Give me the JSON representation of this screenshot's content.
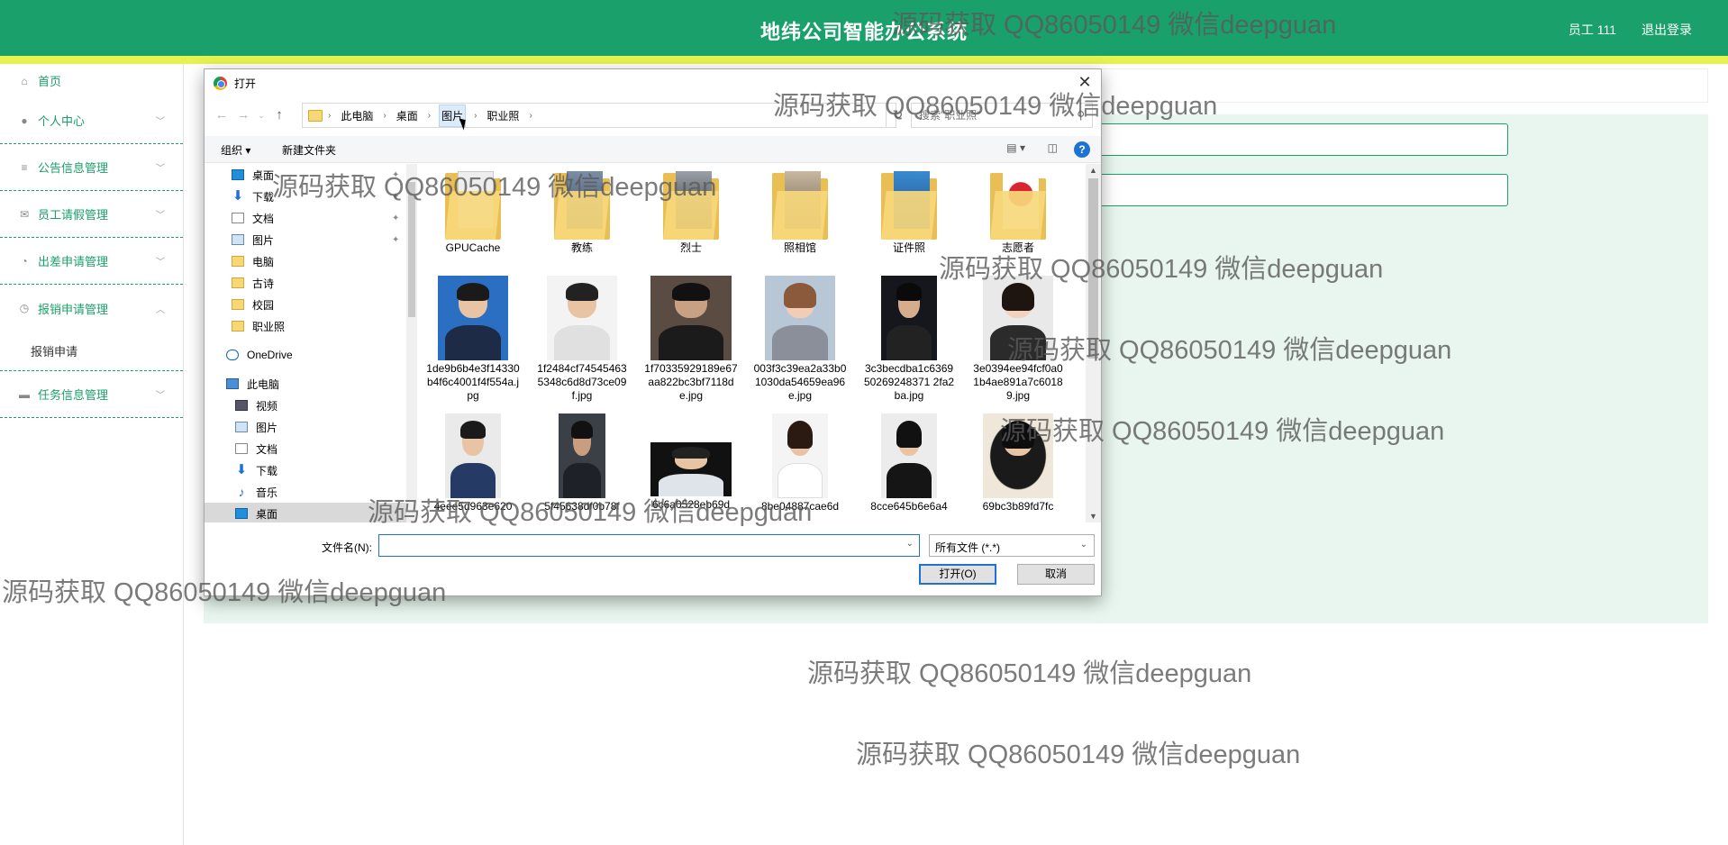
{
  "header": {
    "title": "地纬公司智能办公系统",
    "user": "员工 111",
    "logout": "退出登录"
  },
  "sidebar": {
    "items": [
      {
        "label": "首页",
        "icon": "home-icon"
      },
      {
        "label": "个人中心",
        "icon": "user-icon"
      },
      {
        "label": "公告信息管理",
        "icon": "list-icon"
      },
      {
        "label": "员工请假管理",
        "icon": "mail-icon"
      },
      {
        "label": "出差申请管理",
        "icon": "gauge-icon"
      },
      {
        "label": "报销申请管理",
        "icon": "clock-icon"
      },
      {
        "label": "任务信息管理",
        "icon": "monitor-icon"
      }
    ],
    "sub_item": "报销申请"
  },
  "dialog": {
    "title": "打开",
    "breadcrumbs": [
      "此电脑",
      "桌面",
      "图片",
      "职业照"
    ],
    "search_placeholder": "搜索\"职业照\"",
    "toolbar": {
      "organize": "组织 ▾",
      "new_folder": "新建文件夹"
    },
    "tree": [
      {
        "label": "桌面",
        "icon": "desktop-icon",
        "pinned": true
      },
      {
        "label": "下载",
        "icon": "download-icon",
        "pinned": true
      },
      {
        "label": "文档",
        "icon": "document-icon",
        "pinned": true
      },
      {
        "label": "图片",
        "icon": "picture-icon",
        "pinned": true
      },
      {
        "label": "电脑",
        "icon": "folder-icon"
      },
      {
        "label": "古诗",
        "icon": "folder-icon"
      },
      {
        "label": "校园",
        "icon": "folder-icon"
      },
      {
        "label": "职业照",
        "icon": "folder-icon"
      },
      {
        "label": "OneDrive",
        "icon": "onedrive-icon"
      },
      {
        "label": "此电脑",
        "icon": "computer-icon"
      },
      {
        "label": "视频",
        "icon": "video-icon"
      },
      {
        "label": "图片",
        "icon": "picture-icon"
      },
      {
        "label": "文档",
        "icon": "document-icon"
      },
      {
        "label": "下载",
        "icon": "download-icon"
      },
      {
        "label": "音乐",
        "icon": "music-icon"
      },
      {
        "label": "桌面",
        "icon": "desktop-icon"
      }
    ],
    "files": [
      {
        "name": "GPUCache",
        "kind": "folder"
      },
      {
        "name": "教练",
        "kind": "folder"
      },
      {
        "name": "烈士",
        "kind": "folder"
      },
      {
        "name": "照相馆",
        "kind": "folder"
      },
      {
        "name": "证件照",
        "kind": "folder"
      },
      {
        "name": "志愿者",
        "kind": "folder"
      },
      {
        "name": "1de9b6b4e3f14330b4f6c4001f4f554a.jpg",
        "kind": "photo"
      },
      {
        "name": "1f2484cf745454635348c6d8d73ce09f.jpg",
        "kind": "photo"
      },
      {
        "name": "1f70335929189e67aa822bc3bf7118de.jpg",
        "kind": "photo"
      },
      {
        "name": "003f3c39ea2a33b01030da54659ea96e.jpg",
        "kind": "photo"
      },
      {
        "name": "3c3becdba1c636950269248371 2fa2ba.jpg",
        "kind": "photo"
      },
      {
        "name": "3e0394ee94fcf0a01b4ae891a7c60189.jpg",
        "kind": "photo"
      },
      {
        "name": "4eee5d963e620",
        "kind": "photo"
      },
      {
        "name": "5f45638df0b78f",
        "kind": "photo"
      },
      {
        "name": "6c6a0528eb69d",
        "kind": "photo"
      },
      {
        "name": "8be04887cae6d",
        "kind": "photo"
      },
      {
        "name": "8cce645b6e6a4",
        "kind": "photo"
      },
      {
        "name": "69bc3b89fd7fc",
        "kind": "photo"
      }
    ],
    "filename_label": "文件名(N):",
    "filename_value": "",
    "filetype": "所有文件 (*.*)",
    "open_button": "打开(O)",
    "cancel_button": "取消"
  },
  "watermark": "源码获取 QQ86050149 微信deepguan",
  "colors": {
    "primary": "#1aa06a",
    "stripe": "#e6f24e",
    "panel": "#e8f6ef",
    "accent": "#1e73d2"
  }
}
